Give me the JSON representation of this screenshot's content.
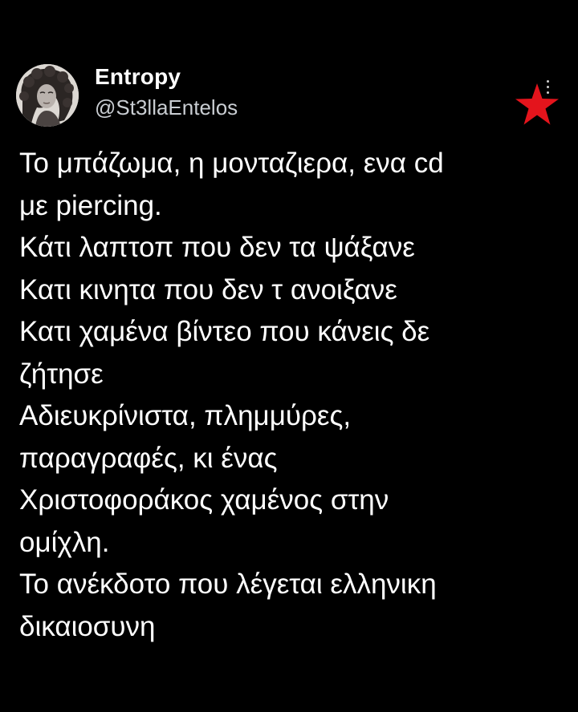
{
  "tweet": {
    "author": {
      "display_name": "Entropy",
      "handle": "@St3llaEntelos",
      "avatar_icon": "profile-avatar"
    },
    "more_icon": "more-options-icon",
    "badge_icon": "red-star-icon",
    "badge_color": "#e4141c",
    "text_lines": [
      "Το μπάζωμα, η μονταζιερα, ενα cd",
      "με piercing.",
      "Κάτι λαπτοπ που δεν τα ψάξανε",
      "Κατι κινητα που δεν τ ανοιξανε",
      "Κατι χαμένα βίντεο που κάνεις δε",
      "ζήτησε",
      "Αδιευκρίνιστα,  πλημμύρες,",
      "παραγραφές,  κι ένας",
      "Χριστοφοράκος χαμένος στην",
      "ομίχλη.",
      "Το ανέκδοτο που λέγεται ελληνικη",
      "δικαιοσυνη"
    ]
  }
}
